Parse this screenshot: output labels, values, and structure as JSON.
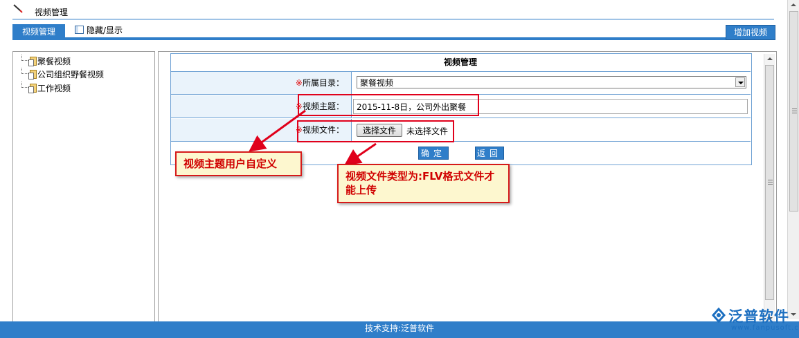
{
  "window": {
    "title": "视频管理"
  },
  "toolbar": {
    "tab_label": "视频管理",
    "toggle_label": "隐藏/显示",
    "add_label": "增加视频"
  },
  "tree": {
    "items": [
      {
        "label": "聚餐视频"
      },
      {
        "label": "公司组织野餐视频"
      },
      {
        "label": "工作视频"
      }
    ]
  },
  "form": {
    "title": "视频管理",
    "required_mark": "※",
    "directory": {
      "label": "所属目录：",
      "value": "聚餐视频"
    },
    "topic": {
      "label": "视频主题：",
      "value": "2015-11-8日，公司外出聚餐"
    },
    "file": {
      "label": "视频文件：",
      "button_label": "选择文件",
      "status": "未选择文件"
    },
    "ok_label": "确定",
    "back_label": "返回"
  },
  "annotations": {
    "topic_note": "视频主题用户自定义",
    "file_note": "视频文件类型为:FLV格式文件才能上传"
  },
  "footer": {
    "support_text": "技术支持:泛普软件"
  },
  "logo": {
    "name": "泛普软件",
    "url": "www.fanpusoft.com"
  },
  "colors": {
    "accent": "#2f7ec9",
    "highlight_red": "#e0001b",
    "callout_bg": "#fdf7cf",
    "label_bg": "#eaf3fb"
  }
}
